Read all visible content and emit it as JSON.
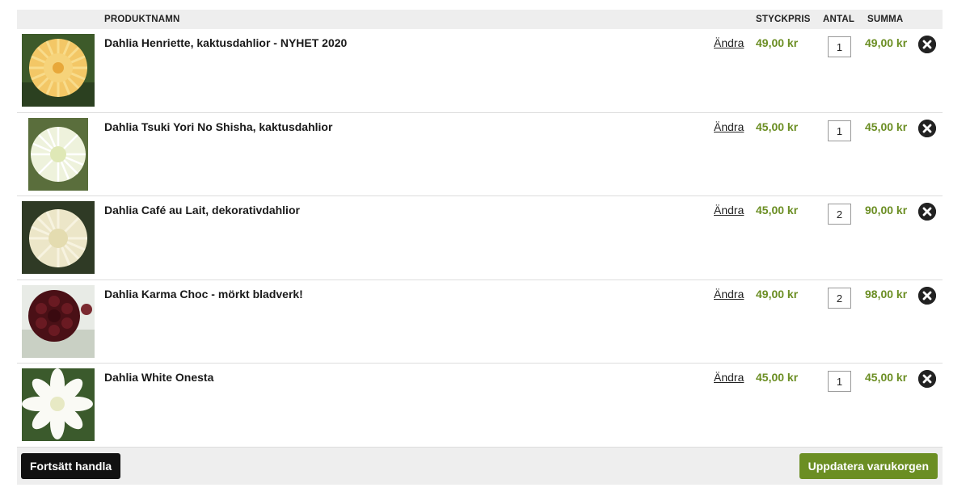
{
  "header": {
    "product_name": "PRODUKTNAMN",
    "unit_price": "STYCKPRIS",
    "quantity": "ANTAL",
    "sum": "SUMMA"
  },
  "items": [
    {
      "name": "Dahlia Henriette, kaktusdahlior - NYHET 2020",
      "edit_label": "Ändra",
      "unit_price": "49,00 kr",
      "quantity": "1",
      "sum": "49,00 kr",
      "image_icon": "yellow-cactus-dahlia-photo"
    },
    {
      "name": "Dahlia Tsuki Yori No Shisha, kaktusdahlior",
      "edit_label": "Ändra",
      "unit_price": "45,00 kr",
      "quantity": "1",
      "sum": "45,00 kr",
      "image_icon": "white-cactus-dahlia-photo"
    },
    {
      "name": "Dahlia Café au Lait, dekorativdahlior",
      "edit_label": "Ändra",
      "unit_price": "45,00 kr",
      "quantity": "2",
      "sum": "90,00 kr",
      "image_icon": "cream-decorative-dahlia-photo"
    },
    {
      "name": "Dahlia Karma Choc - mörkt bladverk!",
      "edit_label": "Ändra",
      "unit_price": "49,00 kr",
      "quantity": "2",
      "sum": "98,00 kr",
      "image_icon": "dark-red-dahlia-photo"
    },
    {
      "name": "Dahlia White Onesta",
      "edit_label": "Ändra",
      "unit_price": "45,00 kr",
      "quantity": "1",
      "sum": "45,00 kr",
      "image_icon": "white-dahlia-photo"
    }
  ],
  "footer": {
    "continue_label": "Fortsätt handla",
    "update_label": "Uppdatera varukorgen"
  },
  "colors": {
    "price_green": "#6b8e23",
    "header_bg": "#eeeeee",
    "continue_bg": "#111111",
    "update_bg": "#6b8e23"
  }
}
